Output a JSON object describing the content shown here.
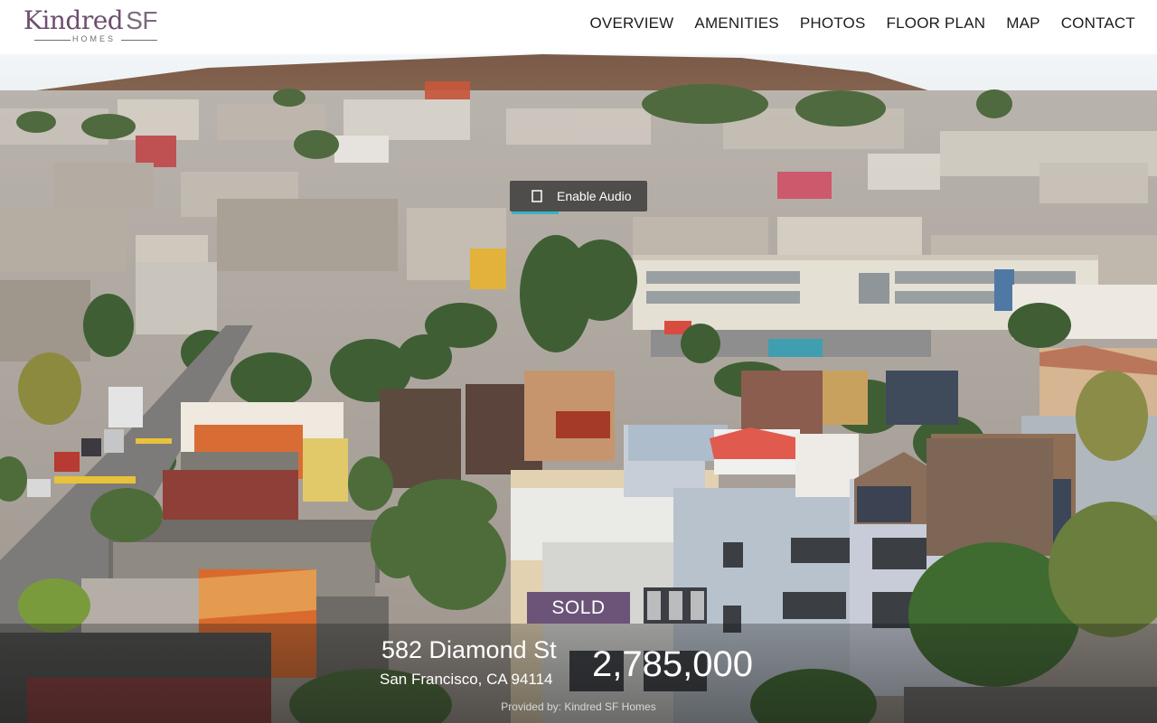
{
  "brand": {
    "logo_word1": "Kindred",
    "logo_word2": "SF",
    "logo_sub": "HOMES",
    "logo_color": "#6d4f6e"
  },
  "nav": {
    "items": [
      {
        "label": "OVERVIEW"
      },
      {
        "label": "AMENITIES"
      },
      {
        "label": "PHOTOS"
      },
      {
        "label": "FLOOR PLAN"
      },
      {
        "label": "MAP"
      },
      {
        "label": "CONTACT"
      }
    ]
  },
  "hero": {
    "audio_button": {
      "label": "Enable Audio",
      "icon": "speaker-icon"
    }
  },
  "listing": {
    "status": "SOLD",
    "status_color": "#6b5478",
    "street": "582 Diamond St",
    "city_line": "San Francisco, CA 94114",
    "price": "2,785,000",
    "provided_by": "Provided by: Kindred SF Homes"
  }
}
